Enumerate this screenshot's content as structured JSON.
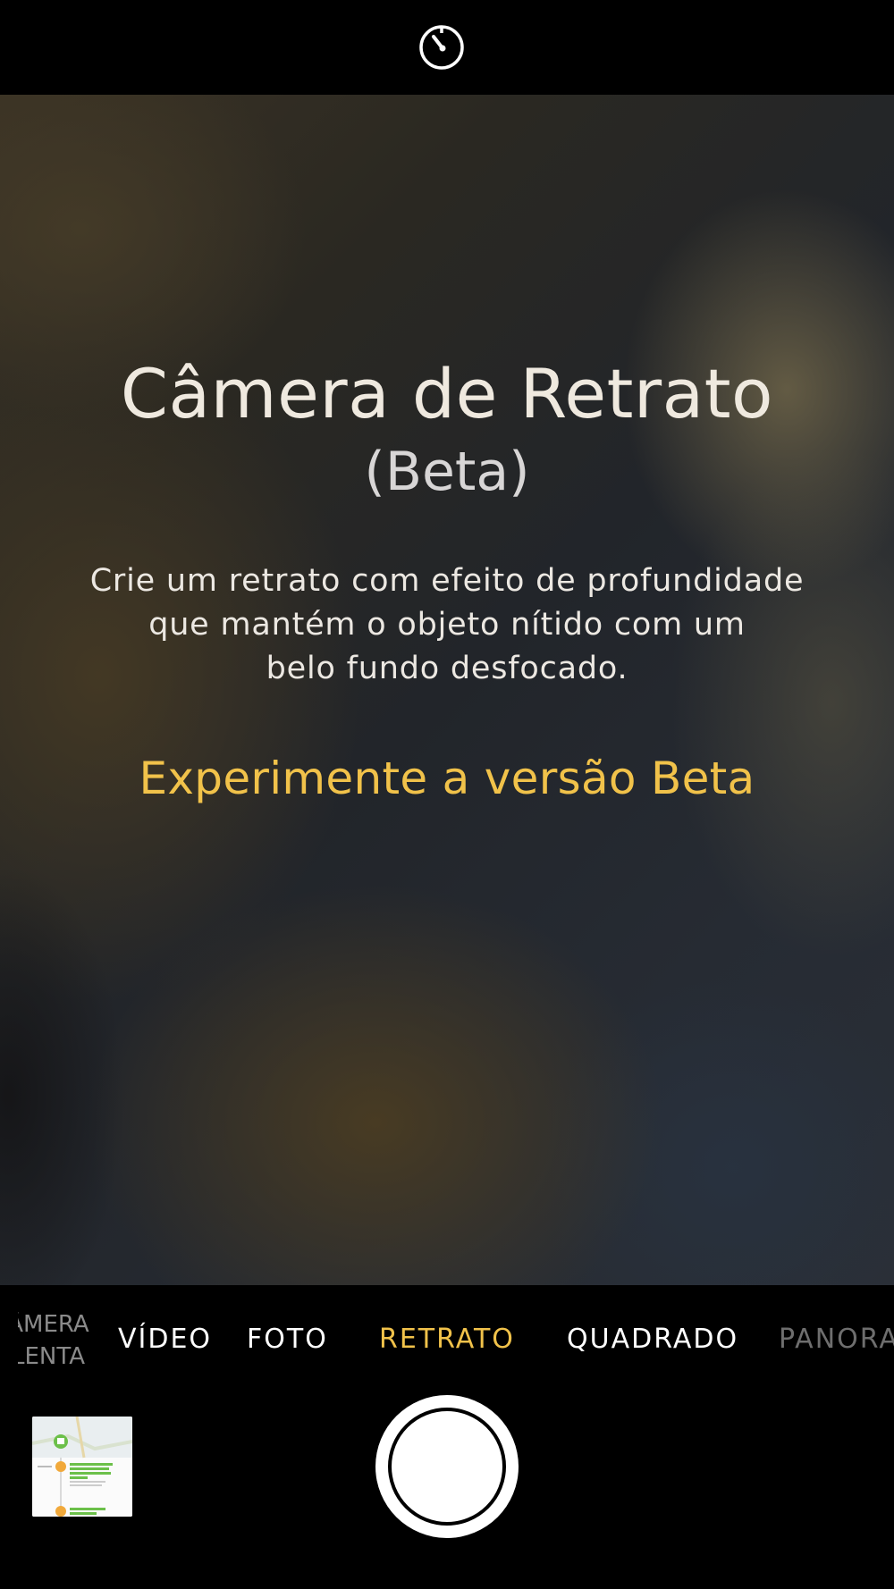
{
  "top_bar": {
    "timer_icon": "timer-icon"
  },
  "viewfinder": {
    "title": "Câmera de Retrato",
    "subtitle": "(Beta)",
    "description_lines": [
      "Crie um retrato com efeito de profundidade",
      "que mantém o objeto nítido com um",
      "belo fundo desfocado."
    ],
    "cta_label": "Experimente a versão Beta"
  },
  "modes": {
    "slow_line1": "ÂMERA",
    "slow_line2": "LENTA",
    "video": "VÍDEO",
    "photo": "FOTO",
    "portrait": "RETRATO",
    "square": "QUADRADO",
    "pano": "PANORA",
    "selected": "RETRATO"
  },
  "colors": {
    "accent": "#f1c24a",
    "bar_background": "#000000",
    "text": "#ffffff"
  },
  "bottom_bar": {
    "thumbnail_icon": "last-photo-thumbnail",
    "shutter_icon": "shutter-button"
  }
}
